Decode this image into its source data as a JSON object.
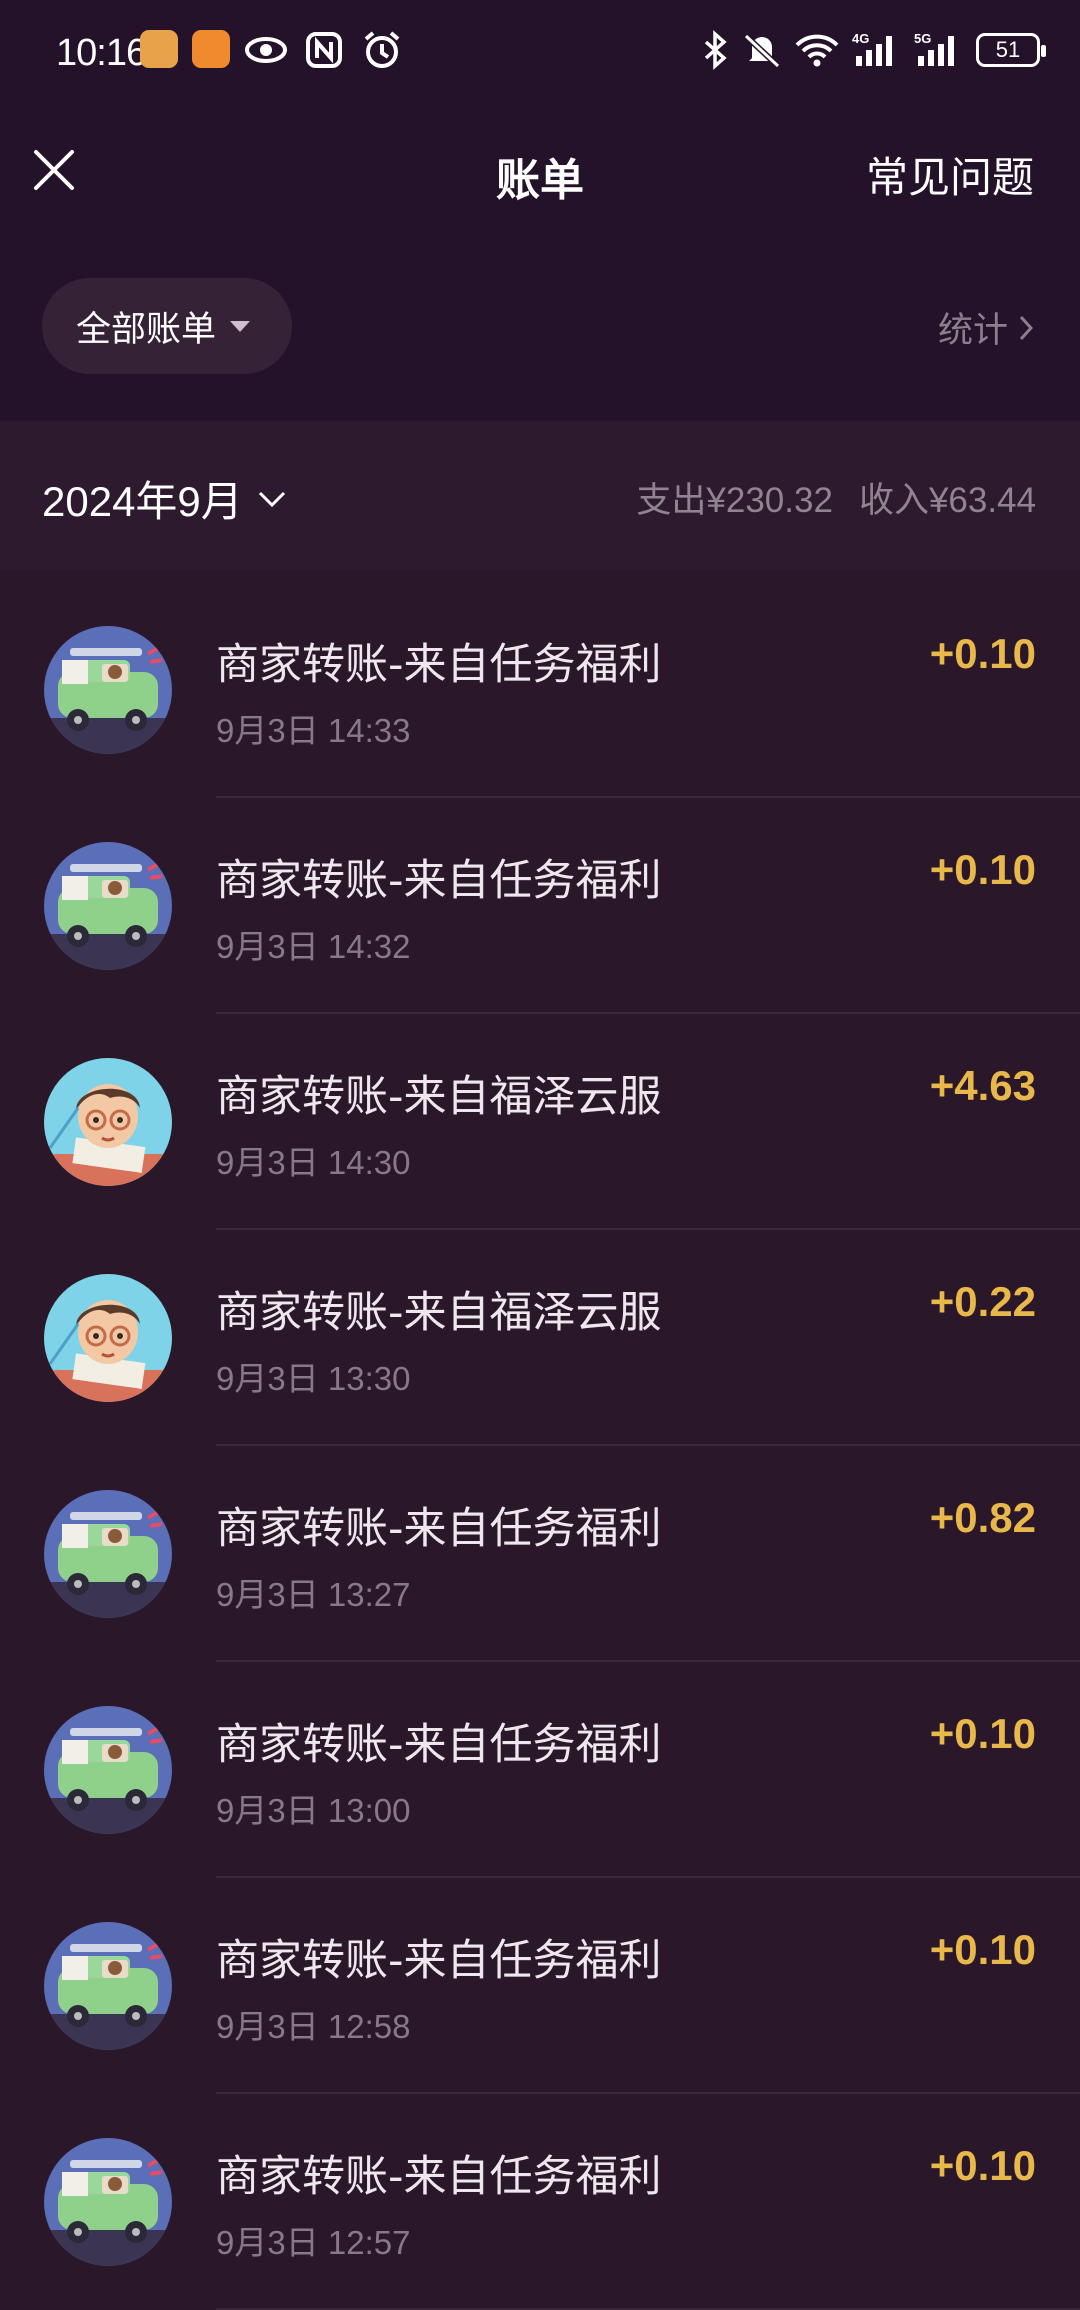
{
  "status": {
    "time": "10:16",
    "battery": "51"
  },
  "header": {
    "title": "账单",
    "faq": "常见问题"
  },
  "filter": {
    "label": "全部账单",
    "stats": "统计"
  },
  "month": {
    "label": "2024年9月",
    "expense": "支出¥230.32",
    "income": "收入¥63.44"
  },
  "transactions": [
    {
      "title": "商家转账-来自任务福利",
      "time": "9月3日 14:33",
      "amount": "+0.10",
      "avatar": "car"
    },
    {
      "title": "商家转账-来自任务福利",
      "time": "9月3日 14:32",
      "amount": "+0.10",
      "avatar": "car"
    },
    {
      "title": "商家转账-来自福泽云服",
      "time": "9月3日 14:30",
      "amount": "+4.63",
      "avatar": "boy"
    },
    {
      "title": "商家转账-来自福泽云服",
      "time": "9月3日 13:30",
      "amount": "+0.22",
      "avatar": "boy"
    },
    {
      "title": "商家转账-来自任务福利",
      "time": "9月3日 13:27",
      "amount": "+0.82",
      "avatar": "car"
    },
    {
      "title": "商家转账-来自任务福利",
      "time": "9月3日 13:00",
      "amount": "+0.10",
      "avatar": "car"
    },
    {
      "title": "商家转账-来自任务福利",
      "time": "9月3日 12:58",
      "amount": "+0.10",
      "avatar": "car"
    },
    {
      "title": "商家转账-来自任务福利",
      "time": "9月3日 12:57",
      "amount": "+0.10",
      "avatar": "car"
    }
  ],
  "colors": {
    "background": "#2a1729",
    "amount": "#e8b94a"
  }
}
